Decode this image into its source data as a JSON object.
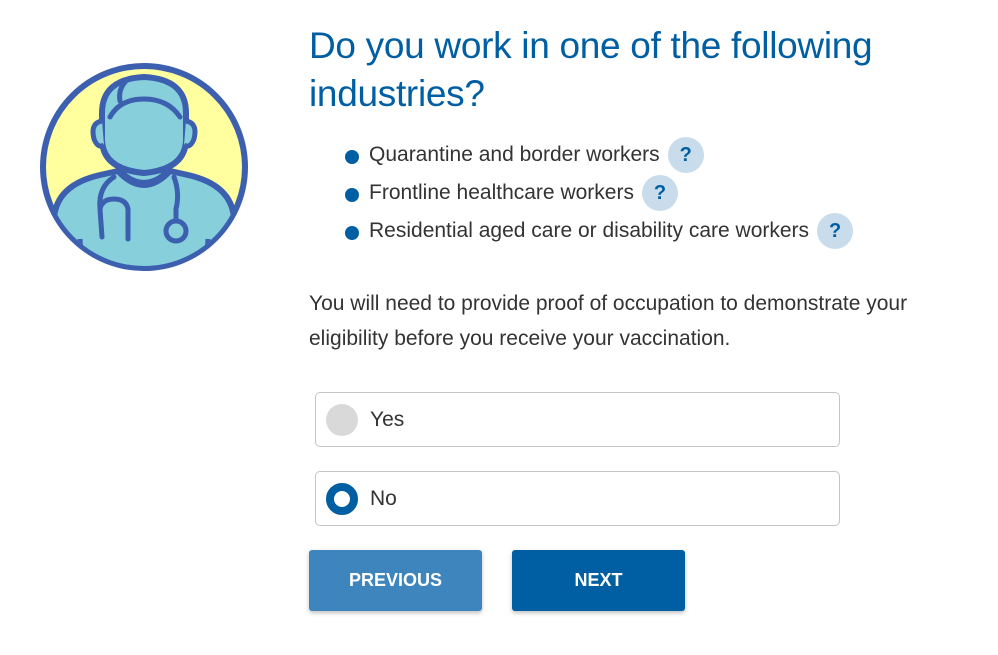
{
  "question": {
    "title": "Do you work in one of the following industries?"
  },
  "industries": [
    {
      "label": "Quarantine and border workers",
      "help_icon": "?"
    },
    {
      "label": "Frontline healthcare workers",
      "help_icon": "?"
    },
    {
      "label": "Residential aged care or disability care workers",
      "help_icon": "?"
    }
  ],
  "notice": "You will need to provide proof of occupation to demonstrate your eligibility before you receive your vaccination.",
  "options": [
    {
      "label": "Yes",
      "selected": false
    },
    {
      "label": "No",
      "selected": true
    }
  ],
  "buttons": {
    "previous": "PREVIOUS",
    "next": "NEXT"
  },
  "icons": {
    "avatar": "healthcare-worker-icon",
    "bullet": "bullet-icon",
    "help": "help-icon"
  },
  "colors": {
    "primary": "#005ea2",
    "primary_light": "#3f85bd",
    "help_bg": "#c8dcec",
    "avatar_bg": "#ffffa0",
    "avatar_fill": "#86cfdb",
    "text": "#333333"
  }
}
